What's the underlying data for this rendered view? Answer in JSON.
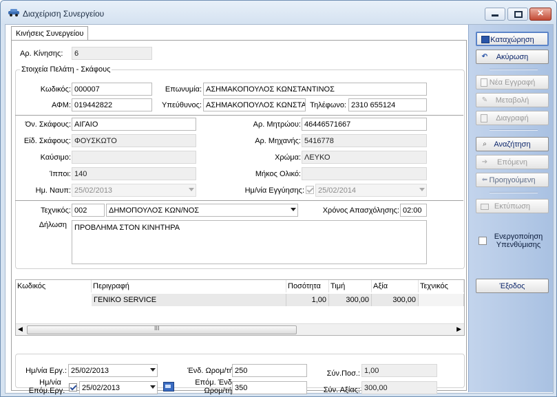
{
  "window": {
    "title": "Διαχείριση Συνεργείου"
  },
  "tab": {
    "label": "Κινήσεις Συνεργείου"
  },
  "movement": {
    "label": "Αρ. Κίνησης:",
    "value": "6"
  },
  "customer_group": {
    "title": "Στοιχεία Πελάτη - Σκάφους",
    "code_label": "Κωδικός:",
    "code_value": "000007",
    "name_label": "Επωνυμία:",
    "name_value": "ΑΣΗΜΑΚΟΠΟΥΛΟΣ ΚΩΝΣΤΑΝΤΙΝΟΣ",
    "afm_label": "ΑΦΜ:",
    "afm_value": "019442822",
    "responsible_label": "Υπεύθυνος:",
    "responsible_value": "ΑΣΗΜΑΚΟΠΟΥΛΟΣ ΚΩΝΣΤΑ",
    "phone_label": "Τηλέφωνο:",
    "phone_value": "2310 655124"
  },
  "vessel": {
    "name_label": "Όν. Σκάφους:",
    "name_value": "ΑΙΓΑΙΟ",
    "registry_label": "Αρ. Μητρώου:",
    "registry_value": "46446571667",
    "type_label": "Είδ. Σκάφους:",
    "type_value": "ΦΟΥΣΚΩΤΟ",
    "engine_label": "Αρ. Μηχανής:",
    "engine_value": "5416778",
    "fuel_label": "Καύσιμο:",
    "fuel_value": "",
    "color_label": "Χρώμα:",
    "color_value": "ΛΕΥΚΟ",
    "hp_label": "Ίπποι:",
    "hp_value": "140",
    "length_label": "Μήκος Ολικό:",
    "length_value": "",
    "launch_label": "Ημ. Ναυπ:",
    "launch_value": "25/02/2013",
    "warranty_label": "Ημ/νία Εγγύησης:",
    "warranty_value": "25/02/2014"
  },
  "technician": {
    "label": "Τεχνικός:",
    "code": "002",
    "name": "ΔΗΜΟΠΟΥΛΟΣ ΚΩΝ/ΝΟΣ",
    "time_label": "Χρόνος Απασχόλησης:",
    "time_value": "02:00"
  },
  "statement": {
    "label": "Δήλωση",
    "value": "ΠΡΟΒΛΗΜΑ ΣΤΟΝ ΚΙΝΗΤΗΡΑ"
  },
  "grid": {
    "headers": [
      "Κωδικός",
      "Περιγραφή",
      "Ποσότητα",
      "Τιμή",
      "Αξία",
      "Τεχνικός"
    ],
    "rows": [
      {
        "code": "",
        "description": "ΓΕΝΙΚΟ SERVICE",
        "quantity": "1,00",
        "price": "300,00",
        "value": "300,00",
        "technician": ""
      }
    ],
    "scroll_grip": "III"
  },
  "footer": {
    "work_date_label": "Ημ/νία Εργ.:",
    "work_date_value": "25/02/2013",
    "next_date_label_1": "Ημ/νία",
    "next_date_label_2": "Επόμ.Εργ.",
    "next_date_value": "25/02/2013",
    "hours_label": "Ένδ. Ωρομ/τή:",
    "hours_value": "250",
    "next_hours_label_1": "Επόμ. Ένδ.",
    "next_hours_label_2": "Ωρομ/τή:",
    "next_hours_value": "350",
    "total_qty_label": "Σύν.Ποσ.:",
    "total_qty_value": "1,00",
    "total_value_label": "Σύν. Αξίας:",
    "total_value_value": "300,00"
  },
  "sidebar": {
    "save": "Καταχώρηση",
    "cancel": "Ακύρωση",
    "new": "Νέα Εγγραφή",
    "edit": "Μεταβολή",
    "delete": "Διαγραφή",
    "search": "Αναζήτηση",
    "next": "Επόμενη",
    "previous": "Προηγούμενη",
    "print": "Εκτύπωση",
    "reminder": "Ενεργοποίηση Υπενθύμισης",
    "exit": "Έξοδος"
  }
}
